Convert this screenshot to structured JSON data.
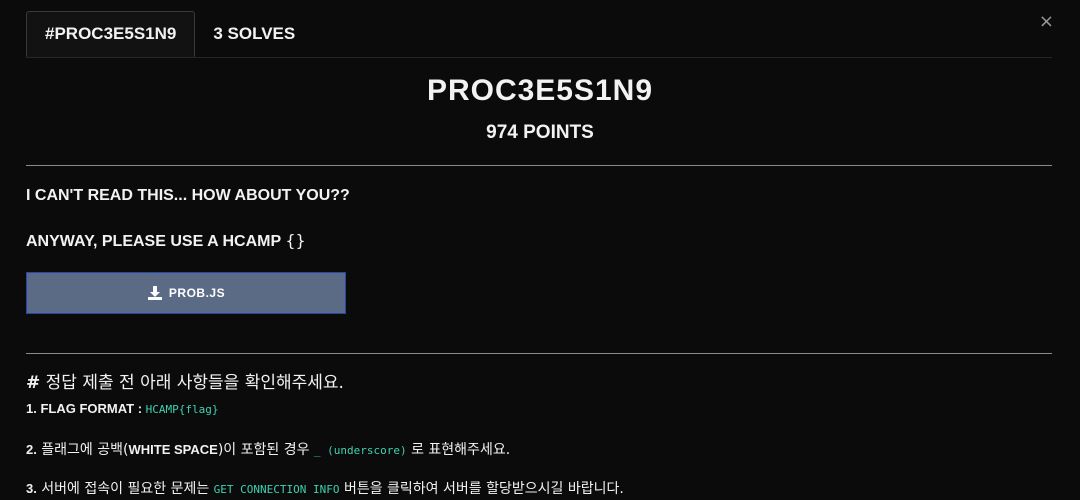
{
  "tabs": [
    {
      "label": "#PROC3E5S1N9",
      "active": true
    },
    {
      "label": "3 SOLVES",
      "active": false
    }
  ],
  "close_label": "×",
  "challenge": {
    "title": "PROC3E5S1N9",
    "points": "974 POINTS",
    "description_line1": "I CAN'T READ THIS... HOW ABOUT YOU??",
    "description_line2_prefix": "ANYWAY, PLEASE USE A HCAMP",
    "description_line2_braces": "{}",
    "download_label": "PROB.JS",
    "download_icon": "download-icon"
  },
  "notice": {
    "hash": "#",
    "heading": " 정답 제출 전 아래 사항들을 확인해주세요.",
    "rules": [
      {
        "num": "1.",
        "bold": " FLAG FORMAT : ",
        "code": "HCAMP{flag}"
      },
      {
        "num": "2.",
        "text_a": " 플래그에 공백(",
        "bold": "WHITE SPACE",
        "text_b": ")이 포함된 경우 ",
        "code": "_ (underscore)",
        "text_c": " 로 표현해주세요."
      },
      {
        "num": "3.",
        "text_a": " 서버에 접속이 필요한 문제는 ",
        "code": "GET CONNECTION INFO",
        "text_b": " 버튼을 클릭하여 서버를 할당받으시길 바랍니다."
      }
    ]
  },
  "colors": {
    "background": "#0b0b0c",
    "button_bg": "#5b6b86",
    "button_border": "#2a46a8",
    "code_color": "#3fd1b0"
  }
}
